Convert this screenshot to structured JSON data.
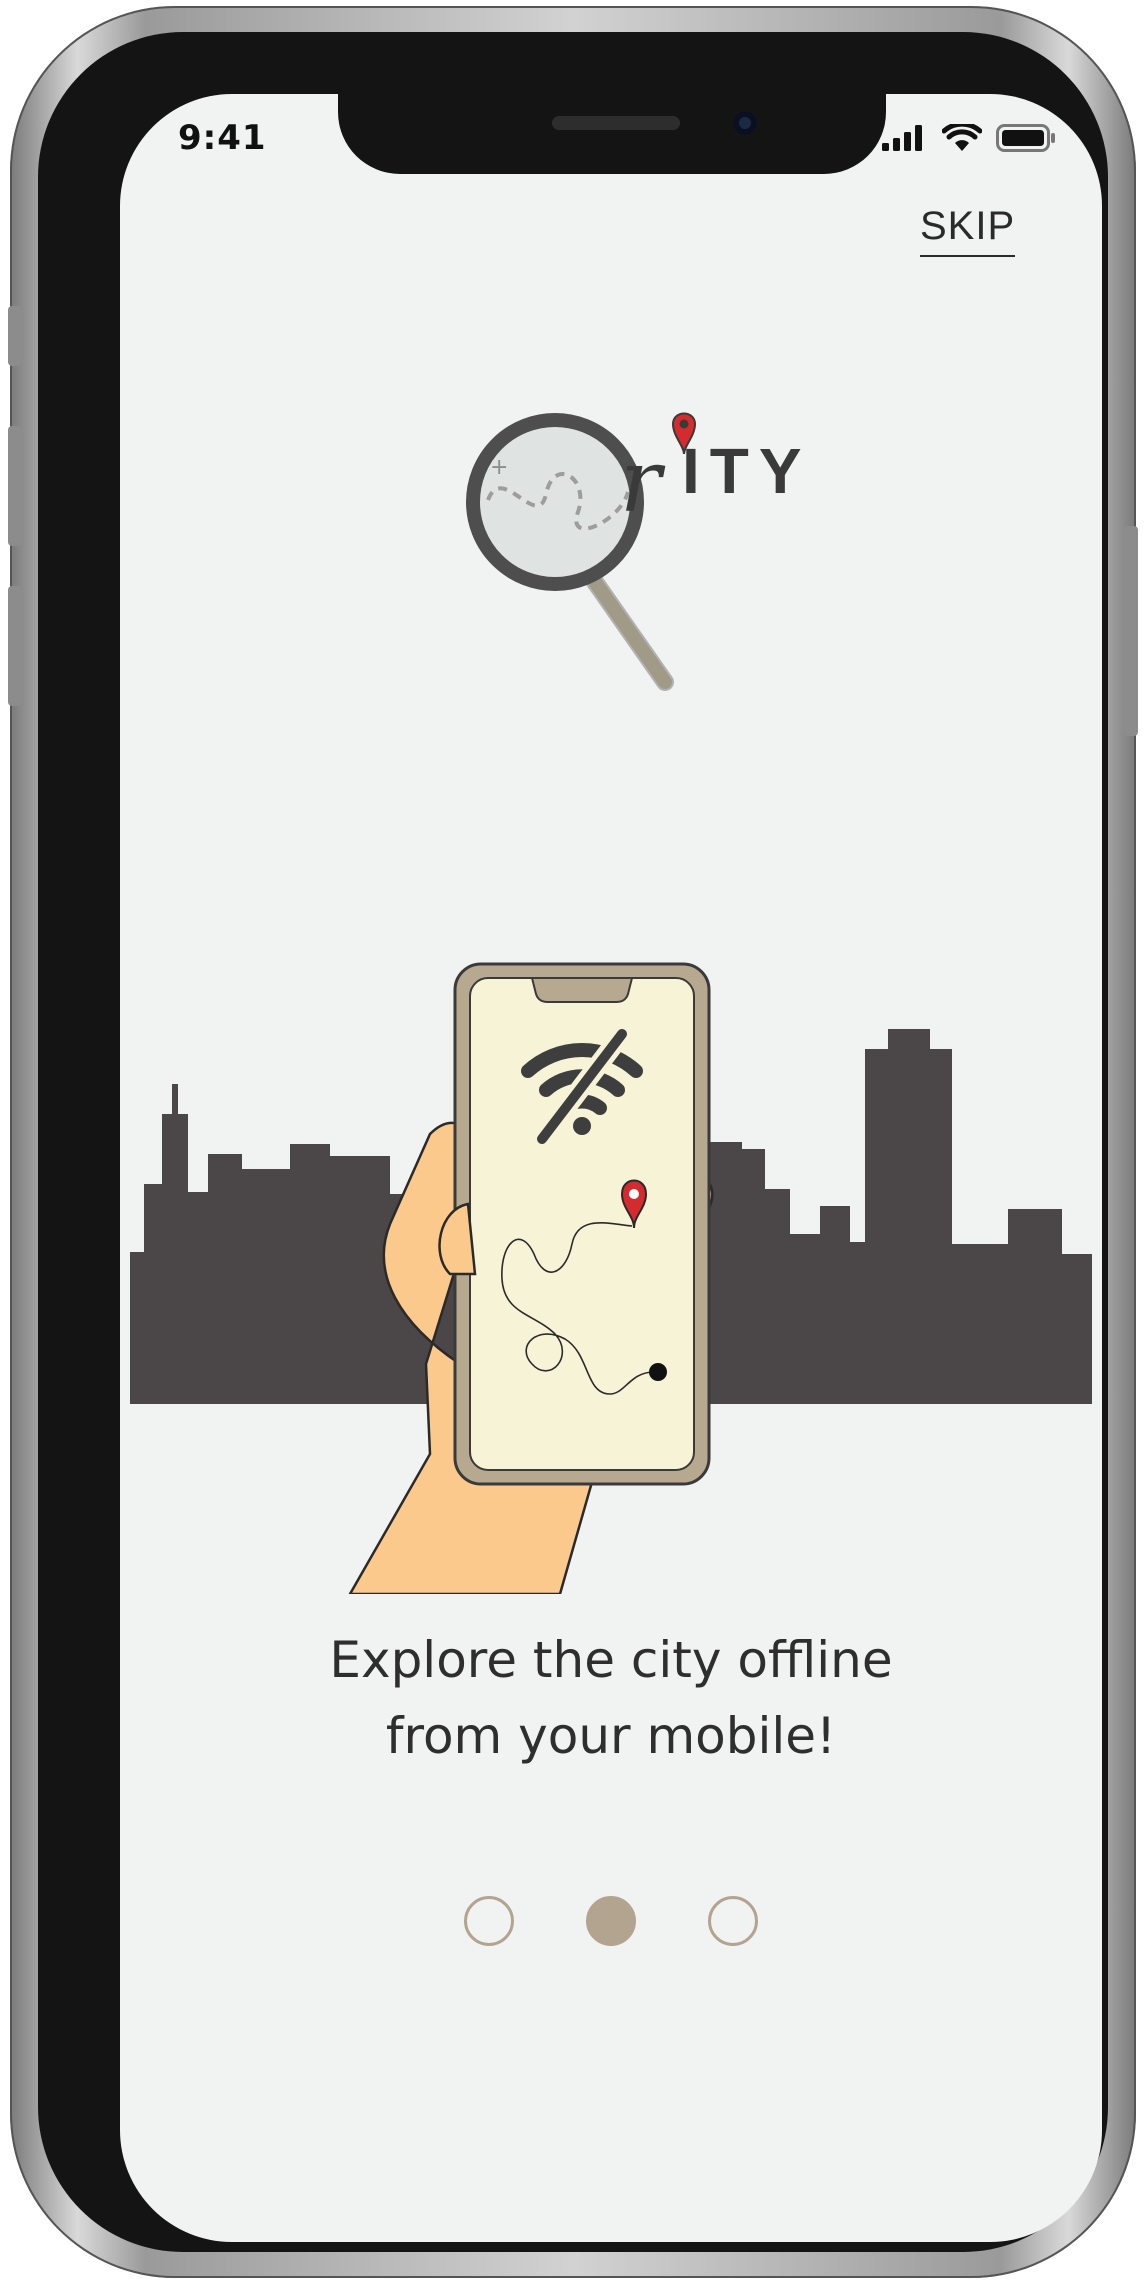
{
  "status_bar": {
    "time": "9:41"
  },
  "header": {
    "skip_label": "SKIP"
  },
  "logo": {
    "text": "ITY",
    "letter": "r"
  },
  "onboarding": {
    "title_line1": "Explore the city offline",
    "title_line2": "from your mobile!",
    "page_count": 3,
    "active_index": 1
  },
  "icons": {
    "status": [
      "signal-icon",
      "wifi-icon",
      "battery-icon"
    ],
    "illustration": [
      "wifi-off-icon",
      "location-pin-icon",
      "route-path",
      "magnifier-icon"
    ]
  },
  "colors": {
    "screen_background": "#f1f2f2",
    "skyline": "#4b4748",
    "accent_beige": "#b3a48f",
    "pin_red": "#d52b2e",
    "hand_skin": "#fbc98b",
    "phone_screen": "#f7f3d6"
  }
}
